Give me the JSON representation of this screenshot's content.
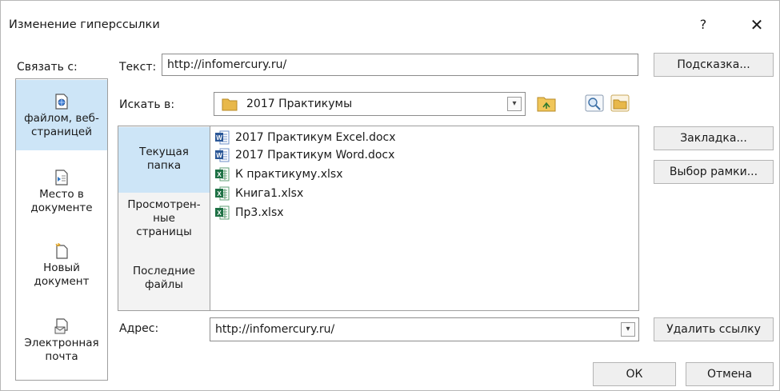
{
  "dialog": {
    "title": "Изменение гиперссылки",
    "help": "?",
    "close": "✕"
  },
  "link_to": {
    "label": "Связать с:",
    "items": [
      {
        "line1": "файлом, веб-",
        "line2": "страницей",
        "icon": "web-page-icon",
        "selected": true
      },
      {
        "line1": "Место в",
        "line2": "документе",
        "icon": "place-in-document-icon",
        "selected": false
      },
      {
        "line1": "Новый",
        "line2": "документ",
        "icon": "new-document-icon",
        "selected": false
      },
      {
        "line1": "Электронная",
        "line2": "почта",
        "icon": "email-icon",
        "selected": false
      }
    ]
  },
  "text_field": {
    "label": "Текст:",
    "value": "http://infomercury.ru/"
  },
  "look_in": {
    "label": "Искать в:",
    "value": "2017 Практикумы"
  },
  "places": [
    {
      "lines": [
        "Текущая",
        "папка"
      ],
      "selected": true
    },
    {
      "lines": [
        "Просмотрен-",
        "ные",
        "страницы"
      ],
      "selected": false
    },
    {
      "lines": [
        "Последние",
        "файлы"
      ],
      "selected": false
    }
  ],
  "files": [
    {
      "name": "2017 Практикум Excel.docx",
      "type": "word"
    },
    {
      "name": "2017 Практикум Word.docx",
      "type": "word"
    },
    {
      "name": "К практикуму.xlsx",
      "type": "excel"
    },
    {
      "name": "Книга1.xlsx",
      "type": "excel"
    },
    {
      "name": "Пр3.xlsx",
      "type": "excel"
    }
  ],
  "address": {
    "label": "Адрес:",
    "value": "http://infomercury.ru/"
  },
  "buttons": {
    "screentip": "Подсказка...",
    "bookmark": "Закладка...",
    "target_frame": "Выбор рамки...",
    "remove_link": "Удалить ссылку",
    "ok": "ОК",
    "cancel": "Отмена"
  },
  "colors": {
    "selection": "#cde5f7",
    "button": "#efefef",
    "word_blue": "#2b5797",
    "excel_green": "#1e7145",
    "folder_yellow": "#e8b84a"
  }
}
